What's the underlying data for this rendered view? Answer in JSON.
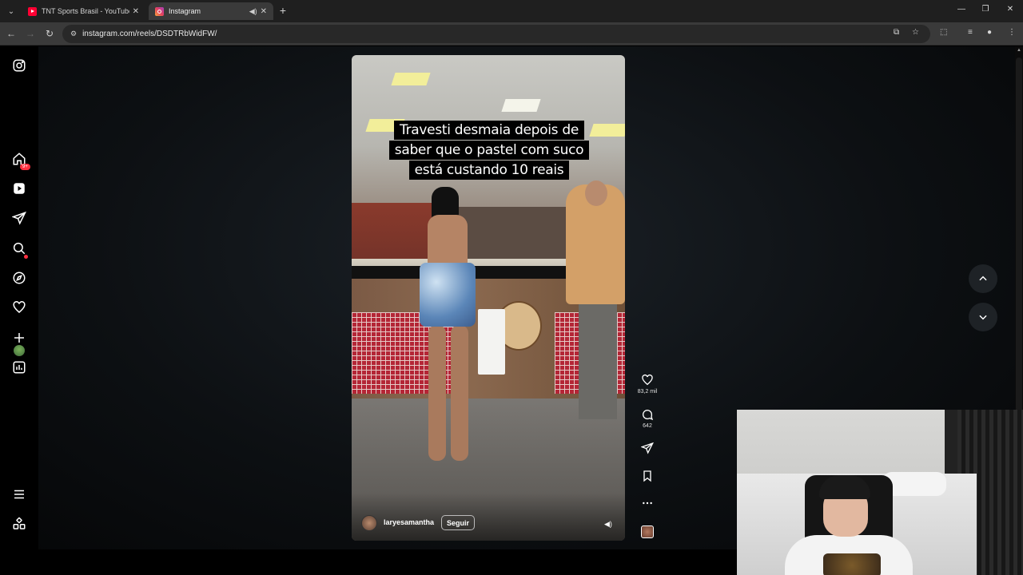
{
  "browser": {
    "tabs": [
      {
        "title": "TNT Sports Brasil - YouTube",
        "favicon": "youtube-icon",
        "active": false
      },
      {
        "title": "Instagram",
        "favicon": "instagram-icon",
        "active": true,
        "playing_audio": true
      }
    ],
    "url": "instagram.com/reels/DSDTRbWidFW/",
    "window_controls": [
      "minimize",
      "restore",
      "close"
    ]
  },
  "sidebar": {
    "items": [
      {
        "name": "instagram-logo-icon"
      },
      {
        "name": "home-icon"
      },
      {
        "name": "reels-icon"
      },
      {
        "name": "messages-icon",
        "badge": "9+"
      },
      {
        "name": "search-icon"
      },
      {
        "name": "explore-icon"
      },
      {
        "name": "notifications-icon",
        "has_dot": true
      },
      {
        "name": "create-icon"
      },
      {
        "name": "dashboard-icon"
      },
      {
        "name": "profile-avatar"
      },
      {
        "name": "more-menu-icon"
      },
      {
        "name": "also-from-meta-icon"
      }
    ]
  },
  "reel": {
    "caption": "Travesti desmaia depois de saber que o pastel com suco está custando 10 reais",
    "author": "laryesamantha",
    "follow_label": "Seguir",
    "likes": "83,2 mil",
    "comments": "642"
  },
  "colors": {
    "accent_red": "#ff3040",
    "background": "#000000"
  }
}
